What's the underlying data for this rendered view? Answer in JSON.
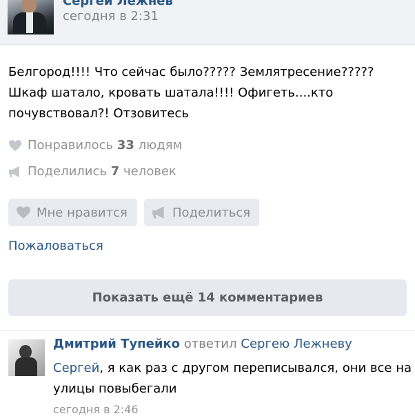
{
  "post": {
    "author": "Сергей Лежнев",
    "time": "сегодня в 2:31",
    "text_lines": [
      "Белгород!!!! Что сейчас было????? Землятресение?????",
      "Шкаф шатало, кровать шатала!!!! Офигеть....кто",
      "почувствовал?! Отзовитесь"
    ],
    "likes": {
      "prefix": "Понравилось",
      "count": "33",
      "suffix": "людям"
    },
    "shares": {
      "prefix": "Поделились",
      "count": "7",
      "suffix": "человек"
    },
    "buttons": {
      "like": "Мне нравится",
      "share": "Поделиться"
    },
    "report": "Пожаловаться",
    "show_more": "Показать ещё 14 комментариев"
  },
  "comment": {
    "author": "Дмитрий Тупейко",
    "reply_word": "ответил",
    "reply_to": "Сергею Лежневу",
    "mention": "Сергей",
    "text_rest": ", я как раз с другом переписывался, они все на",
    "text_line2": "улицы повыбегали",
    "time": "сегодня в 2:46"
  },
  "icons": {
    "heart": "heart-icon",
    "megaphone": "megaphone-icon"
  },
  "colors": {
    "link": "#2a5885",
    "muted": "#939393",
    "button_bg": "#e8ebef",
    "header_bg": "#f0f2f5"
  }
}
